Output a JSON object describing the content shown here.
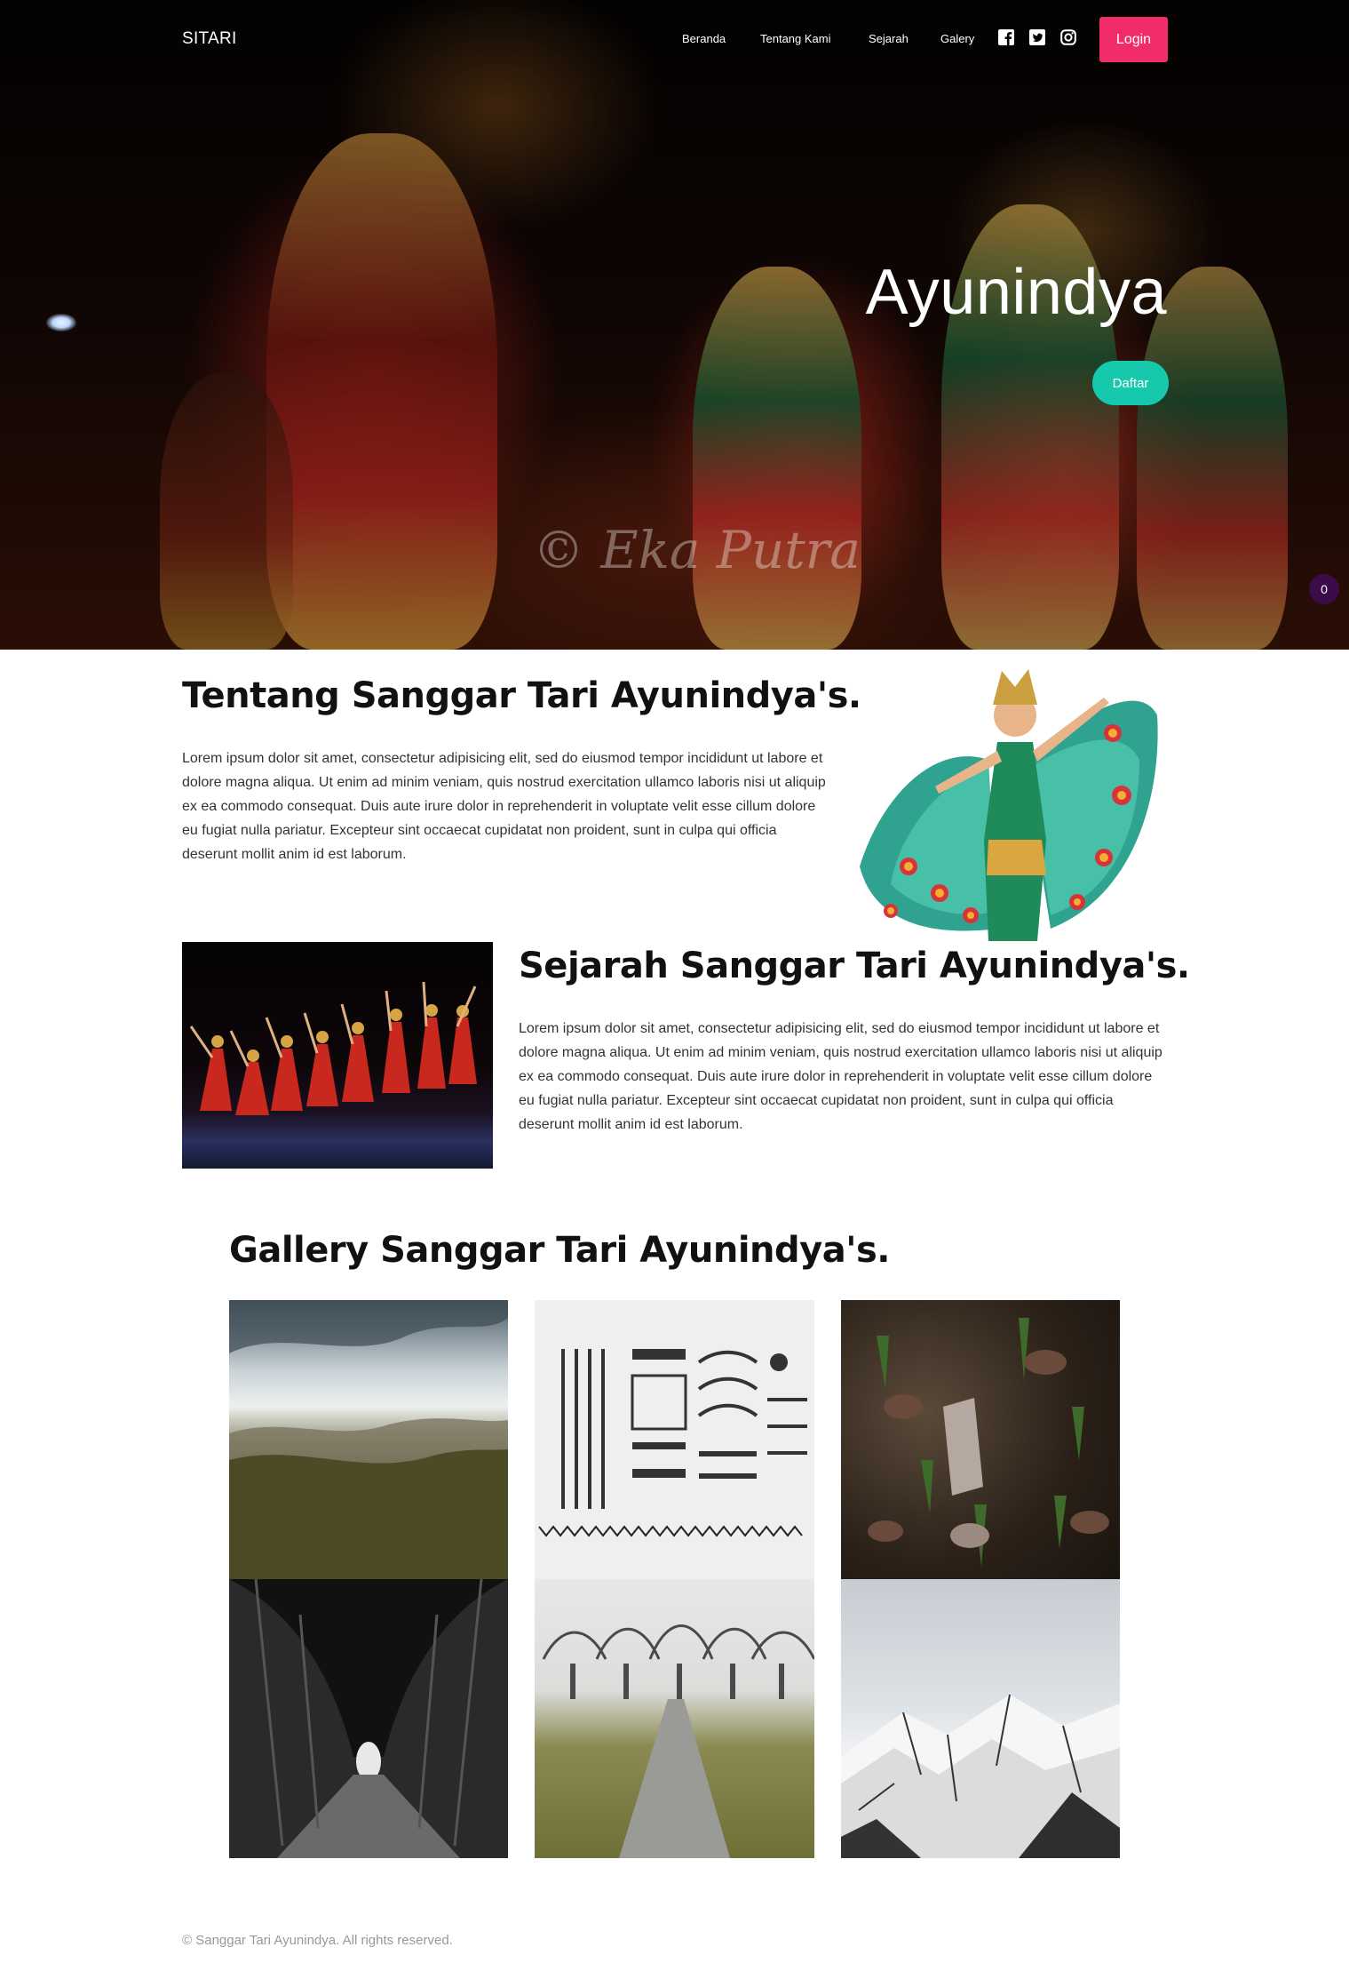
{
  "nav": {
    "logo": "SITARI",
    "links": [
      "Beranda",
      "Tentang Kami",
      "Sejarah",
      "Galery"
    ],
    "social_icons": [
      "facebook-icon",
      "twitter-icon",
      "instagram-icon"
    ],
    "login_label": "Login",
    "login_color": "#f02d69"
  },
  "hero": {
    "title": "Ayunindya",
    "cta_label": "Daftar",
    "cta_color": "#16c9ad",
    "watermark": "© Eka Putra",
    "counter": "0"
  },
  "about": {
    "heading": "Tentang Sanggar Tari Ayunindya's.",
    "body": "Lorem ipsum dolor sit amet, consectetur adipisicing elit, sed do eiusmod tempor incididunt ut labore et dolore magna aliqua. Ut enim ad minim veniam, quis nostrud exercitation ullamco laboris nisi ut aliquip ex ea commodo consequat. Duis aute irure dolor in reprehenderit in voluptate velit esse cillum dolore eu fugiat nulla pariatur. Excepteur sint occaecat cupidatat non proident, sunt in culpa qui officia deserunt mollit anim id est laborum."
  },
  "history": {
    "heading": "Sejarah Sanggar Tari Ayunindya's.",
    "body": "Lorem ipsum dolor sit amet, consectetur adipisicing elit, sed do eiusmod tempor incididunt ut labore et dolore magna aliqua. Ut enim ad minim veniam, quis nostrud exercitation ullamco laboris nisi ut aliquip ex ea commodo consequat. Duis aute irure dolor in reprehenderit in voluptate velit esse cillum dolore eu fugiat nulla pariatur. Excepteur sint occaecat cupidatat non proident, sunt in culpa qui officia deserunt mollit anim id est laborum."
  },
  "gallery": {
    "heading": "Gallery Sanggar Tari Ayunindya's."
  },
  "footer": {
    "text": "© Sanggar Tari Ayunindya. All rights reserved."
  }
}
